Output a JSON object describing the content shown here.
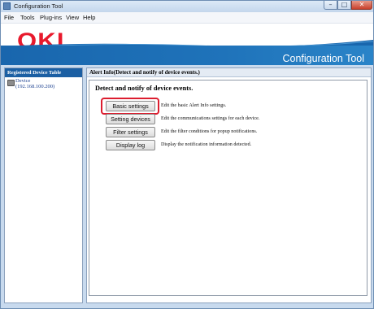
{
  "window": {
    "title": "Configuration Tool"
  },
  "menu": {
    "items": [
      "File",
      "Tools",
      "Plug-ins",
      "View",
      "Help"
    ]
  },
  "header": {
    "logo": "OKI",
    "title": "Configuration Tool"
  },
  "left_panel": {
    "heading": "Registered Device Table",
    "device": {
      "name": "Device",
      "ip": "(192.168.100.200)"
    }
  },
  "main": {
    "heading": "Alert Info(Detect and notify of device events.)",
    "section_title": "Detect and notify of device events.",
    "actions": [
      {
        "label": "Basic settings",
        "description": "Edit the basic Alert Info settings."
      },
      {
        "label": "Setting devices",
        "description": "Edit the communications settings for each device."
      },
      {
        "label": "Filter settings",
        "description": "Edit the filter conditions for popup notifications."
      },
      {
        "label": "Display log",
        "description": "Display the notification information detected."
      }
    ]
  },
  "colors": {
    "brand_red": "#e8192c",
    "brand_blue": "#1966ad",
    "highlight": "#dc1d2f"
  },
  "icons": {
    "app": "config-app-icon",
    "device": "printer-icon"
  }
}
